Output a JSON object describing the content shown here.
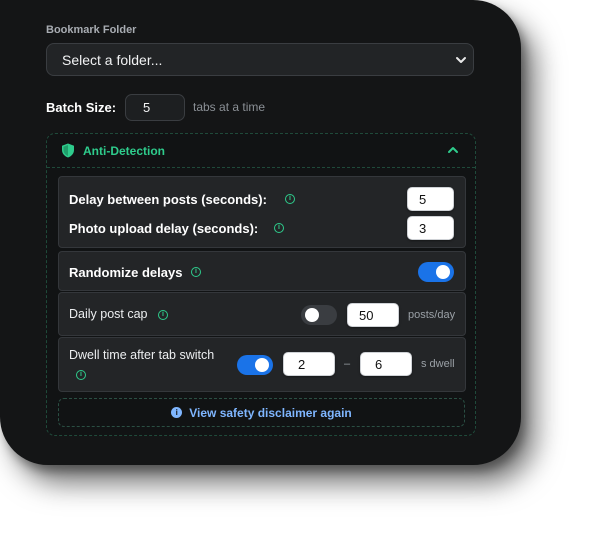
{
  "folder": {
    "label": "Bookmark Folder",
    "selected": "Select a folder..."
  },
  "batch": {
    "label": "Batch Size:",
    "value": "5",
    "suffix": "tabs at a time"
  },
  "anti_detection": {
    "title": "Anti-Detection",
    "delay_posts": {
      "label": "Delay between posts (seconds):",
      "value": "5"
    },
    "photo_delay": {
      "label": "Photo upload delay (seconds):",
      "value": "3"
    },
    "randomize": {
      "label": "Randomize delays",
      "enabled": true
    },
    "daily_cap": {
      "label": "Daily post cap",
      "enabled": false,
      "value": "50",
      "unit": "posts/day"
    },
    "dwell": {
      "label": "Dwell time after tab switch",
      "enabled": true,
      "min": "2",
      "separator": "–",
      "max": "6",
      "unit": "s dwell"
    },
    "disclaimer_link": "View safety disclaimer again"
  },
  "colors": {
    "accent_green": "#2ecc8c",
    "toggle_on": "#1a73e8",
    "link_blue": "#7fb6ff",
    "panel_bg": "#141516"
  },
  "icons": [
    "chevron-down-icon",
    "shield-icon",
    "chevron-up-icon",
    "info-icon"
  ]
}
